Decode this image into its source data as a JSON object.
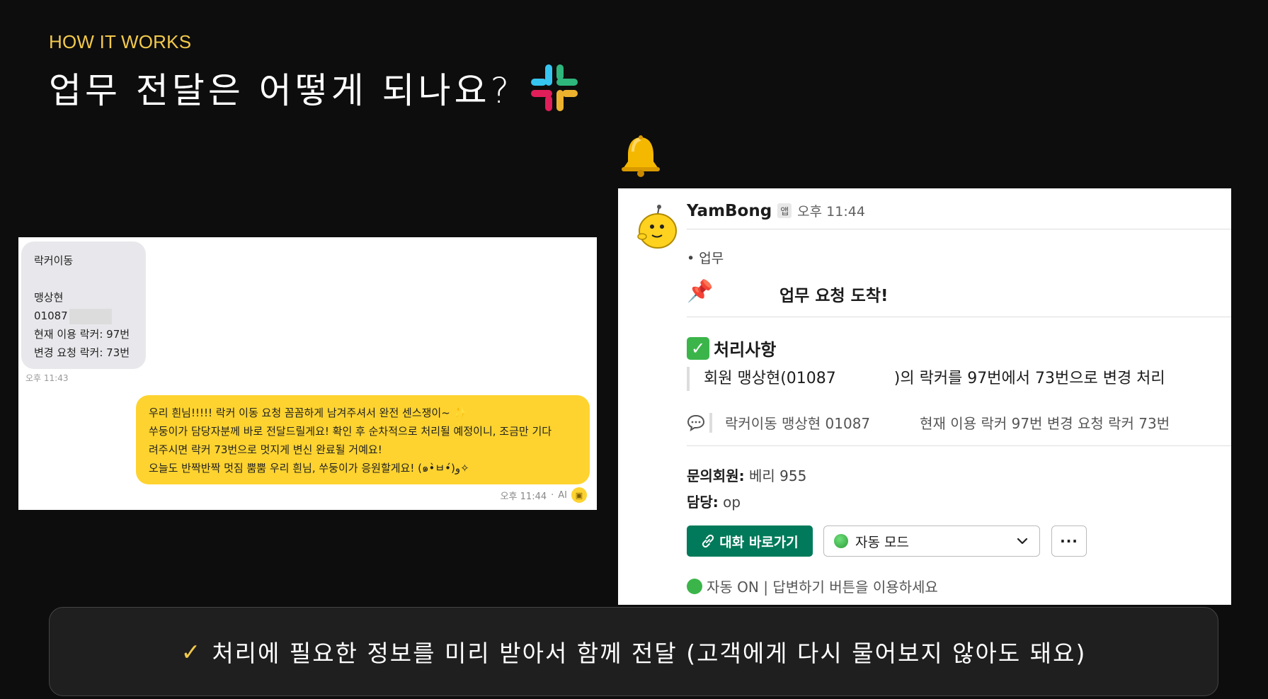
{
  "header": {
    "eyebrow": "HOW IT WORKS",
    "title": "업무 전달은 어떻게 되나요?"
  },
  "chat": {
    "incoming": {
      "line1": "락커이동",
      "line2": "맹상현",
      "line3": "01087",
      "line4": "현재 이용 락커: 97번",
      "line5": "변경 요청 락커: 73번",
      "time": "오후 11:43"
    },
    "outgoing": {
      "line1": "우리 흰님!!!!! 락커 이동 요청 꼼꼼하게 남겨주셔서 완전 센스쟁이~ ✨",
      "line2": "쑤둥이가 담당자분께 바로 전달드릴게요! 확인 후 순차적으로 처리될 예정이니, 조금만 기다",
      "line3": "려주시면 락커 73번으로 멋지게 변신 완료될 거예요!",
      "line4": "오늘도 반짝반짝 멋짐 뿜뿜 우리 흰님, 쑤둥이가 응원할게요! (๑•̀ㅂ•́)و✧",
      "time": "오후 11:44",
      "ai_label": "AI"
    }
  },
  "slack": {
    "bot_name": "YamBong",
    "app_badge": "앱",
    "time": "오후 11:44",
    "topic": "• 업무",
    "headline": "업무 요청 도착!",
    "section_title": "처리사항",
    "quote_part1": "회원 맹상현(01087",
    "quote_part2": ")의 락커를 97번에서 73번으로 변경 처리",
    "comment_part1": "락커이동 맹상현 01087",
    "comment_part2": "현재 이용 락커 97번 변경 요청 락커 73번",
    "member_label": "문의회원:",
    "member_value": "베리 955",
    "owner_label": "담당:",
    "owner_value": "op",
    "open_button": "대화 바로가기",
    "mode_select": "자동 모드",
    "more_button": "···",
    "status": "자동 ON | 답변하기 버튼을 이용하세요"
  },
  "callout": {
    "mark": "✓",
    "text": "처리에 필요한 정보를 미리 받아서 함께 전달 (고객에게 다시 물어보지 않아도 돼요)"
  },
  "colors": {
    "accent": "#f2c94c",
    "kakao_yellow": "#fed32f",
    "slack_green": "#007a5a"
  },
  "icons": [
    "slack-logo-icon",
    "bell-icon",
    "avatar-icon",
    "pin-icon",
    "check-icon",
    "comment-icon",
    "link-icon",
    "chevron-down-icon",
    "green-dot-icon"
  ]
}
